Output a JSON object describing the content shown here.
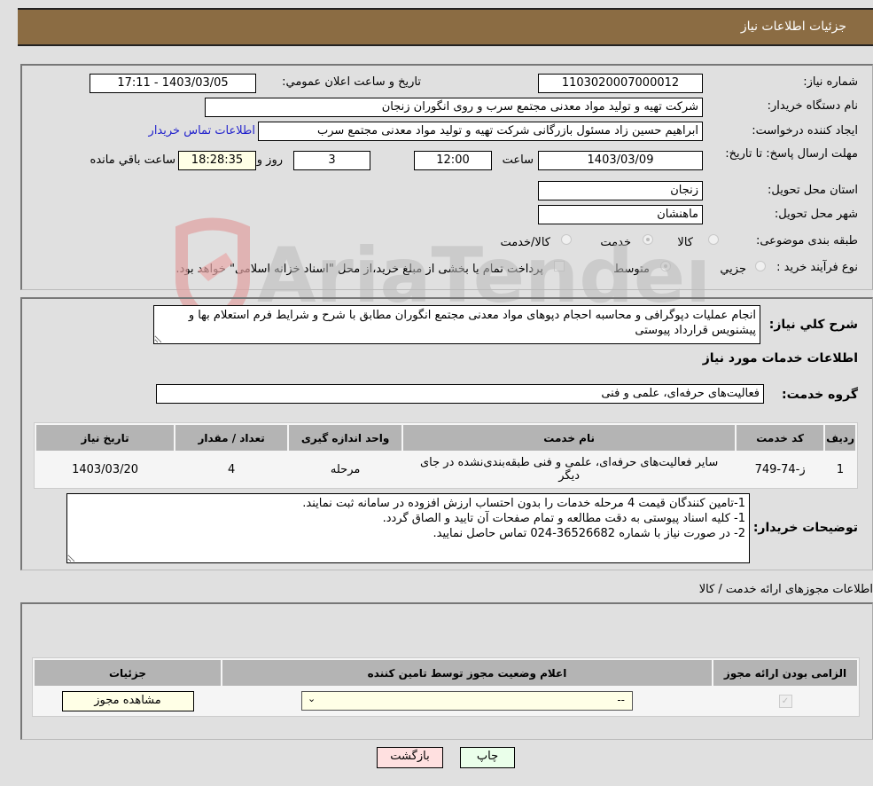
{
  "header": {
    "title": "جزئیات اطلاعات نیاز"
  },
  "info": {
    "need_number_label": "شماره نیاز:",
    "need_number": "1103020007000012",
    "announce_label": "تاریخ و ساعت اعلان عمومي:",
    "announce_value": "1403/03/05 - 17:11",
    "buyer_org_label": "نام دستگاه خریدار:",
    "buyer_org": "شرکت تهیه و تولید مواد معدنی مجتمع سرب و روی انگوران   زنجان",
    "creator_label": "ایجاد کننده درخواست:",
    "creator": "ابراهیم حسین زاد مسئول بازرگانی شرکت تهیه و تولید مواد معدنی مجتمع سرب",
    "contact_link": "اطلاعات تماس خریدار",
    "deadline_label": "مهلت ارسال پاسخ: تا تاریخ:",
    "deadline_date": "1403/03/09",
    "time_label": "ساعت",
    "deadline_time": "12:00",
    "days_value": "3",
    "days_label": "روز و",
    "remaining_time": "18:28:35",
    "remaining_label": "ساعت باقي مانده",
    "province_label": "استان محل تحویل:",
    "province": "زنجان",
    "city_label": "شهر محل تحویل:",
    "city": "ماهنشان",
    "category_label": "طبقه بندی موضوعی:",
    "category_options": [
      "کالا",
      "خدمت",
      "کالا/خدمت"
    ],
    "category_selected": "خدمت",
    "process_label": "نوع فرآیند خرید :",
    "process_options": [
      "جزيي",
      "متوسط"
    ],
    "process_selected": "متوسط",
    "treasury_note": "پرداخت تمام یا بخشی از مبلغ خرید،از محل \"اسناد خزانه اسلامی\" خواهد بود."
  },
  "description": {
    "label": "شرح کلي نياز:",
    "text": "انجام عملیات دپوگرافی و محاسبه احجام دپوهای مواد معدنی مجتمع انگوران مطابق با شرح و شرایط فرم استعلام بها و پیشنویس قرارداد پیوستی",
    "services_title": "اطلاعات خدمات مورد نیاز",
    "service_group_label": "گروه خدمت:",
    "service_group": "فعالیت‌های حرفه‌ای، علمی و فنی"
  },
  "services_table": {
    "headers": [
      "ردیف",
      "کد خدمت",
      "نام خدمت",
      "واحد اندازه گیری",
      "تعداد / مقدار",
      "تاریخ نیاز"
    ],
    "rows": [
      [
        "1",
        "ز-74-749",
        "سایر فعالیت‌های حرفه‌ای، علمی و فنی طبقه‌بندی‌نشده در جای دیگر",
        "مرحله",
        "4",
        "1403/03/20"
      ]
    ]
  },
  "buyer_notes": {
    "label": "توضیحات خریدار:",
    "text": "1-تامین کنندگان قیمت 4 مرحله خدمات را بدون احتساب ارزش افزوده در سامانه ثبت نمایند.\n1- کلیه اسناد پیوستی به دقت مطالعه و تمام صفحات آن تایید و الصاق گردد.\n2- در صورت نیاز با شماره 36526682-024 تماس حاصل نمایید."
  },
  "permits": {
    "title": "اطلاعات مجوزهای ارائه خدمت / کالا",
    "headers": [
      "الزامی بودن ارائه مجوز",
      "اعلام وضعیت مجوز توسط تامین کننده",
      "جزئیات"
    ],
    "row": {
      "required_checked": true,
      "status_value": "--",
      "details_button": "مشاهده مجوز"
    }
  },
  "buttons": {
    "print": "چاپ",
    "back": "بازگشت"
  },
  "watermark": {
    "text": "AriaTender.neT"
  },
  "colors": {
    "header_bg": "#8b6c43",
    "link": "#2222cc",
    "print_bg": "#eaffea",
    "back_bg": "#ffe0e0",
    "field_yellow": "#ffffe6"
  }
}
